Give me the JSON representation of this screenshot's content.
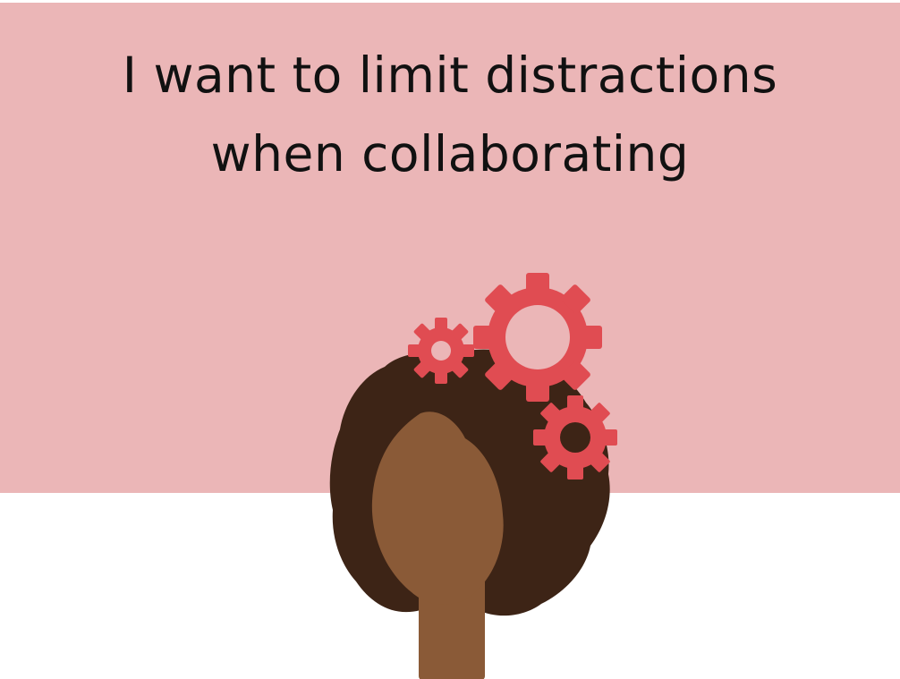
{
  "headline": {
    "line1": "I want to limit distractions",
    "line2": "when collaborating"
  },
  "colors": {
    "background_banner": "#ebb6b7",
    "background_page": "#ffffff",
    "text": "#111111",
    "hair": "#3d2416",
    "skin": "#8a5a37",
    "gear": "#e04c52"
  },
  "icons": [
    "person-head-illustration",
    "gear-icon"
  ]
}
